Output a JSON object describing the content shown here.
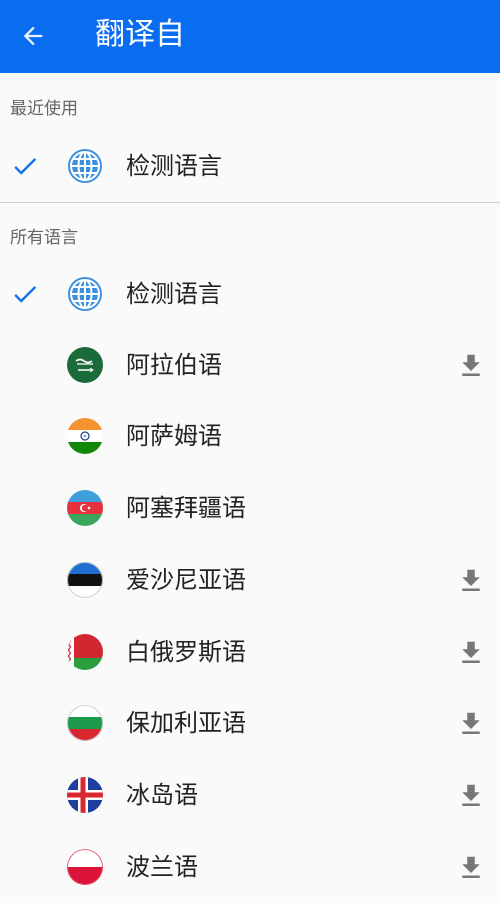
{
  "header": {
    "title": "翻译自",
    "back_icon": "arrow-left-icon"
  },
  "recent": {
    "header": "最近使用",
    "items": [
      {
        "label": "检测语言",
        "selected": true,
        "icon": "globe-icon",
        "downloadable": false
      }
    ]
  },
  "all": {
    "header": "所有语言",
    "items": [
      {
        "label": "检测语言",
        "selected": true,
        "icon": "globe-icon",
        "downloadable": false
      },
      {
        "label": "阿拉伯语",
        "selected": false,
        "icon": "saudi-flag-icon",
        "downloadable": true
      },
      {
        "label": "阿萨姆语",
        "selected": false,
        "icon": "india-flag-icon",
        "downloadable": false
      },
      {
        "label": "阿塞拜疆语",
        "selected": false,
        "icon": "azerbaijan-flag-icon",
        "downloadable": false
      },
      {
        "label": "爱沙尼亚语",
        "selected": false,
        "icon": "estonia-flag-icon",
        "downloadable": true
      },
      {
        "label": "白俄罗斯语",
        "selected": false,
        "icon": "belarus-flag-icon",
        "downloadable": true
      },
      {
        "label": "保加利亚语",
        "selected": false,
        "icon": "bulgaria-flag-icon",
        "downloadable": true
      },
      {
        "label": "冰岛语",
        "selected": false,
        "icon": "iceland-flag-icon",
        "downloadable": true
      },
      {
        "label": "波兰语",
        "selected": false,
        "icon": "poland-flag-icon",
        "downloadable": true
      }
    ]
  },
  "colors": {
    "appbar": "#0a6cf0",
    "check": "#1a73e8",
    "download": "#777777"
  }
}
